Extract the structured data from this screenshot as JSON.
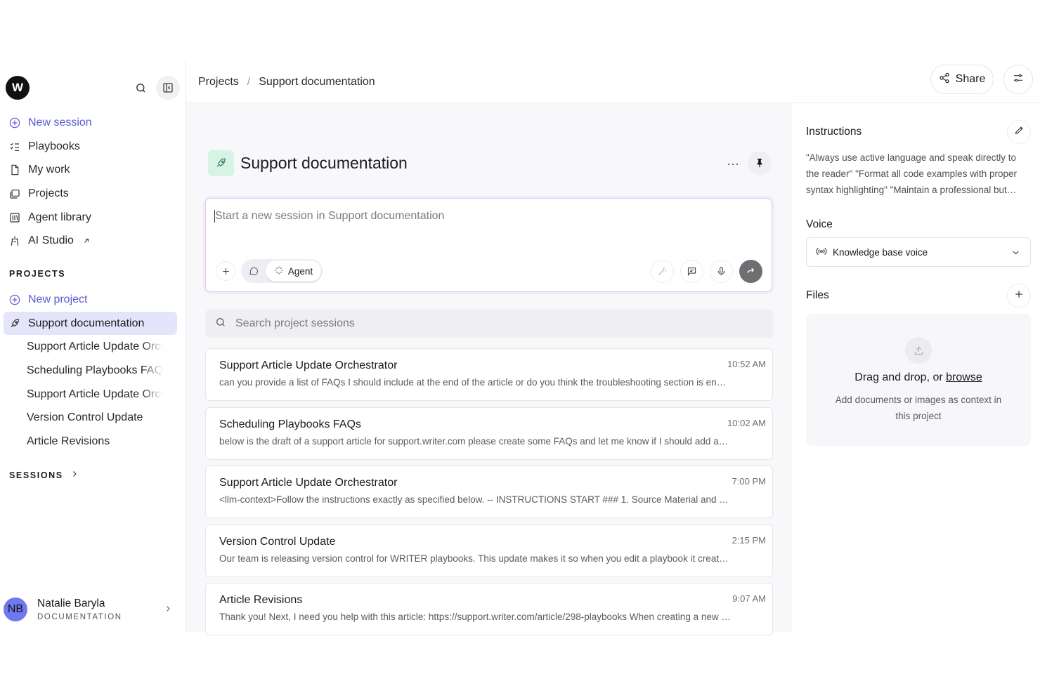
{
  "sidebar": {
    "logo_letter": "W",
    "nav": [
      {
        "label": "New session",
        "icon": "plus-circle-icon"
      },
      {
        "label": "Playbooks",
        "icon": "list-checks-icon"
      },
      {
        "label": "My work",
        "icon": "document-icon"
      },
      {
        "label": "Projects",
        "icon": "folders-icon"
      },
      {
        "label": "Agent library",
        "icon": "library-icon"
      },
      {
        "label": "AI Studio",
        "icon": "studio-icon"
      }
    ],
    "projects_label": "PROJECTS",
    "new_project_label": "New project",
    "active_project": "Support documentation",
    "project_sessions": [
      "Support Article Update Orchestrator",
      "Scheduling Playbooks FAQs",
      "Support Article Update Orchestrator",
      "Version Control Update",
      "Article Revisions"
    ],
    "sessions_label": "SESSIONS",
    "user": {
      "initials": "NB",
      "name": "Natalie Baryla",
      "role": "DOCUMENTATION"
    }
  },
  "header": {
    "breadcrumb_root": "Projects",
    "breadcrumb_sep": "/",
    "breadcrumb_current": "Support documentation",
    "share_label": "Share"
  },
  "project": {
    "title": "Support documentation",
    "more_label": "···"
  },
  "composer": {
    "placeholder": "Start a new session in Support documentation",
    "agent_label": "Agent"
  },
  "search": {
    "placeholder": "Search project sessions"
  },
  "sessions": [
    {
      "title": "Support Article Update Orchestrator",
      "time": "10:52 AM",
      "preview": "can you provide a list of FAQs I should include at the end of the article or do you think the troubleshooting section is enough for now?"
    },
    {
      "title": "Scheduling Playbooks FAQs",
      "time": "10:02 AM",
      "preview": "below is the draft of a support article for support.writer.com please create some FAQs and let me know if I should add anything else"
    },
    {
      "title": "Support Article Update Orchestrator",
      "time": "7:00 PM",
      "preview": "<llm-context>Follow the instructions exactly as specified below. -- INSTRUCTIONS START ### 1. Source Material and Context Gathering"
    },
    {
      "title": "Version Control Update",
      "time": "2:15 PM",
      "preview": "Our team is releasing version control for WRITER playbooks. This update makes it so when you edit a playbook it creates a new version"
    },
    {
      "title": "Article Revisions",
      "time": "9:07 AM",
      "preview": "Thank you! Next, I need you help with this article: https://support.writer.com/article/298-playbooks When creating a new playbook"
    }
  ],
  "right_panel": {
    "instructions_label": "Instructions",
    "instructions_text": "\"Always use active language and speak directly to the reader\" \"Format all code examples with proper syntax highlighting\" \"Maintain a professional but friendly tone\"",
    "voice_label": "Voice",
    "voice_value": "Knowledge base voice",
    "files_label": "Files",
    "drop_text": "Drag and drop, or ",
    "browse_label": "browse",
    "drop_sub": "Add documents or images as context in this project"
  },
  "colors": {
    "accent": "#5b5bd6",
    "active_bg": "#e4e4fb",
    "project_icon_bg": "#d7f3e5",
    "avatar_bg": "#6f78ee"
  }
}
